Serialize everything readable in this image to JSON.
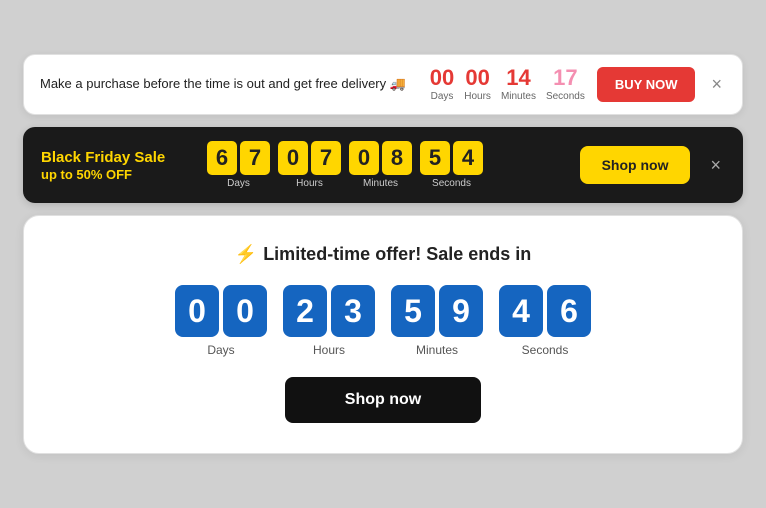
{
  "banner1": {
    "text": "Make a purchase before the time is out and get free delivery 🚚",
    "countdown": {
      "days": {
        "value": "00",
        "label": "Days"
      },
      "hours": {
        "value": "00",
        "label": "Hours"
      },
      "minutes": {
        "value": "14",
        "label": "Minutes"
      },
      "seconds": {
        "value": "17",
        "label": "Seconds"
      }
    },
    "buy_button": "BUY NOW",
    "close_label": "×"
  },
  "banner2": {
    "title": "Black Friday Sale",
    "subtitle": "up to 50% OFF",
    "countdown": {
      "days": {
        "d1": "6",
        "d2": "7",
        "label": "Days"
      },
      "hours": {
        "d1": "0",
        "d2": "7",
        "label": "Hours"
      },
      "minutes": {
        "d1": "0",
        "d2": "8",
        "label": "Minutes"
      },
      "seconds": {
        "d1": "5",
        "d2": "4",
        "label": "Seconds"
      }
    },
    "shop_button": "Shop now",
    "close_label": "×"
  },
  "banner3": {
    "icon": "⚡",
    "title": "Limited-time offer! Sale ends in",
    "countdown": {
      "days": {
        "d1": "0",
        "d2": "0",
        "label": "Days"
      },
      "hours": {
        "d1": "2",
        "d2": "3",
        "label": "Hours"
      },
      "minutes": {
        "d1": "5",
        "d2": "9",
        "label": "Minutes"
      },
      "seconds": {
        "d1": "4",
        "d2": "6",
        "label": "Seconds"
      }
    },
    "shop_button": "Shop now"
  }
}
